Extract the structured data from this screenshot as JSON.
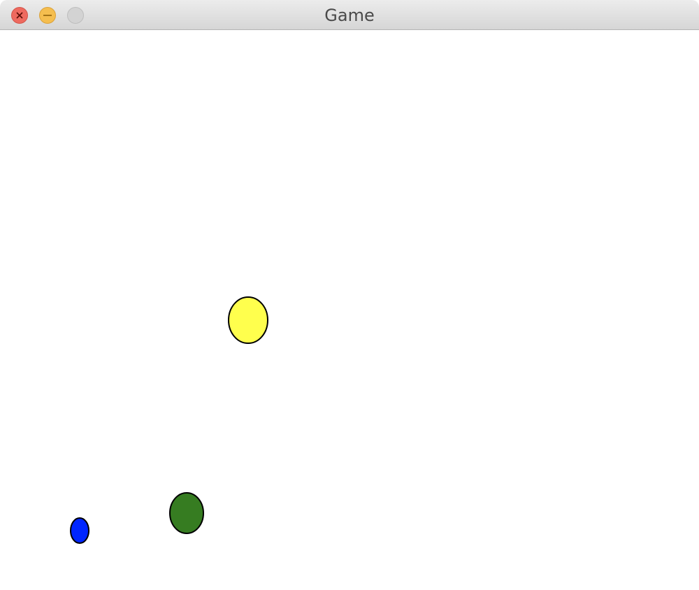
{
  "window": {
    "title": "Game",
    "buttons": {
      "close": "close",
      "minimize": "minimize",
      "zoom": "zoom"
    }
  },
  "game": {
    "balls": [
      {
        "name": "yellow-ball",
        "color": "#ffff4d"
      },
      {
        "name": "green-ball",
        "color": "#367c21"
      },
      {
        "name": "blue-ball",
        "color": "#0026ff"
      }
    ],
    "outline_color": "#000000"
  }
}
